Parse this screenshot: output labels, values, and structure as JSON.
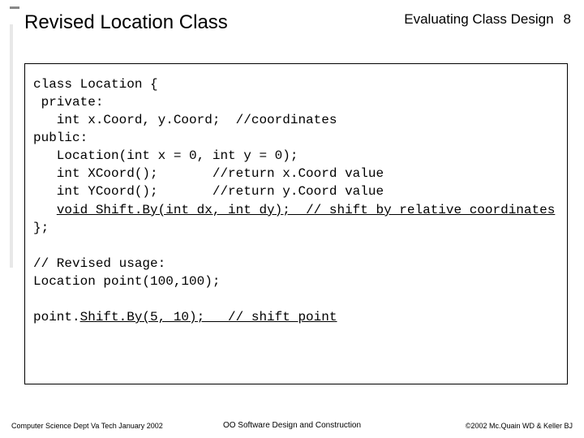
{
  "header": {
    "title": "Revised Location Class",
    "section": "Evaluating Class Design",
    "page": "8"
  },
  "code": {
    "l1": "class Location {",
    "l2": " private:",
    "l3": "   int x.Coord, y.Coord;  //coordinates",
    "l4": "public:",
    "l5": "   Location(int x = 0, int y = 0);",
    "l6": "   int XCoord();       //return x.Coord value",
    "l7": "   int YCoord();       //return y.Coord value",
    "l8a": "   ",
    "l8b": "void Shift.By(int dx, int dy);  // shift by relative coordinates",
    "l9": "};",
    "l10": "",
    "l11": "// Revised usage:",
    "l12": "Location point(100,100);",
    "l13": "",
    "l14a": "point.",
    "l14b": "Shift.By(5, 10);   // shift point"
  },
  "footer": {
    "left": "Computer Science Dept Va Tech January 2002",
    "center": "OO Software Design and Construction",
    "right": "©2002 Mc.Quain WD & Keller BJ"
  }
}
